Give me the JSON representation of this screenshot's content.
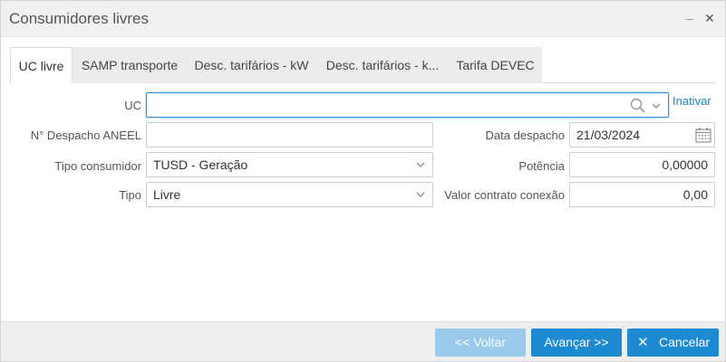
{
  "window": {
    "title": "Consumidores livres",
    "minimize_icon": "minimize-icon",
    "close_icon": "close-icon"
  },
  "tabs": [
    {
      "label": "UC livre",
      "active": true
    },
    {
      "label": "SAMP transporte",
      "active": false
    },
    {
      "label": "Desc. tarifários - kW",
      "active": false
    },
    {
      "label": "Desc. tarifários - k...",
      "active": false
    },
    {
      "label": "Tarifa DEVEC",
      "active": false
    }
  ],
  "form": {
    "uc": {
      "label": "UC",
      "value": "",
      "icons": [
        "search-icon",
        "chevron-down-icon"
      ]
    },
    "inativar_link": "Inativar",
    "despacho_aneel": {
      "label": "N° Despacho ANEEL",
      "value": ""
    },
    "data_despacho": {
      "label": "Data despacho",
      "value": "21/03/2024"
    },
    "tipo_consumidor": {
      "label": "Tipo consumidor",
      "value": "TUSD - Geração"
    },
    "potencia": {
      "label": "Potência",
      "value": "0,00000"
    },
    "tipo": {
      "label": "Tipo",
      "value": "Livre"
    },
    "valor_contrato": {
      "label": "Valor contrato conexão",
      "value": "0,00"
    }
  },
  "footer": {
    "prev_label": "<< Voltar",
    "next_label": "Avançar >>",
    "cancel_label": "Cancelar",
    "cancel_icon": "close-icon"
  },
  "colors": {
    "accent": "#1e8ad2",
    "accent_disabled": "#9ac9ea",
    "link": "#1e88c7",
    "focus_border": "#3a8fd6"
  }
}
